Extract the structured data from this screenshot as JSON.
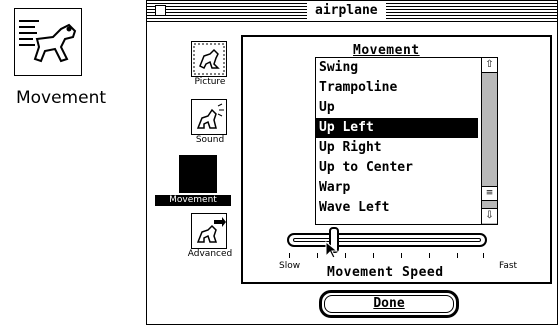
{
  "desktop": {
    "icon_name": "dog-movement-icon",
    "label": "Movement"
  },
  "window": {
    "title": "airplane"
  },
  "sidebar": {
    "items": [
      {
        "label": "Picture",
        "icon": "dog-picture-icon",
        "selected": false
      },
      {
        "label": "Sound",
        "icon": "dog-sound-icon",
        "selected": false
      },
      {
        "label": "Movement",
        "icon": "dog-movement-icon",
        "selected": true
      },
      {
        "label": "Advanced",
        "icon": "dog-advanced-icon",
        "selected": false
      }
    ]
  },
  "panel": {
    "title": "Movement",
    "list": {
      "items": [
        "Swing",
        "Trampoline",
        "Up",
        "Up Left",
        "Up Right",
        "Up to Center",
        "Warp",
        "Wave Left"
      ],
      "selected": "Up Left"
    },
    "speed": {
      "title": "Movement Speed",
      "min_label": "Slow",
      "max_label": "Fast",
      "value_fraction": 0.2
    }
  },
  "buttons": {
    "done_label": "Done"
  }
}
